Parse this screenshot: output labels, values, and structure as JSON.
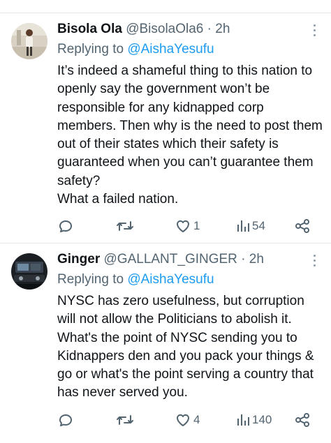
{
  "tweets": [
    {
      "author_name": "Bisola Ola",
      "handle": "@BisolaOla6",
      "time": "· 2h",
      "replying_prefix": "Replying to ",
      "replying_to": "@AishaYesufu",
      "text": "It’s indeed a shameful thing to this nation to openly say the government won’t be responsible for any kidnapped corp members. Then why is the need to post them out of their states which their safety is guaranteed when you can’t guarantee them safety?\nWhat a failed nation.",
      "likes": "1",
      "views": "54"
    },
    {
      "author_name": "Ginger",
      "handle": "@GALLANT_GINGER",
      "time": "· 2h",
      "replying_prefix": "Replying to ",
      "replying_to": "@AishaYesufu",
      "text": "NYSC has zero usefulness, but corruption will not allow the Politicians to abolish it. What's the point of NYSC  sending you to Kidnappers den and you pack your things & go or what's the point serving a country that has never served you.",
      "likes": "4",
      "views": "140"
    }
  ],
  "icons": {
    "reply": "reply-icon",
    "retweet": "retweet-icon",
    "like": "heart-icon",
    "views": "views-icon",
    "share": "share-icon",
    "more": "more-icon"
  },
  "colors": {
    "text": "#0f1419",
    "secondary": "#536471",
    "link": "#1d9bf0",
    "divider": "#e6e9ea"
  }
}
